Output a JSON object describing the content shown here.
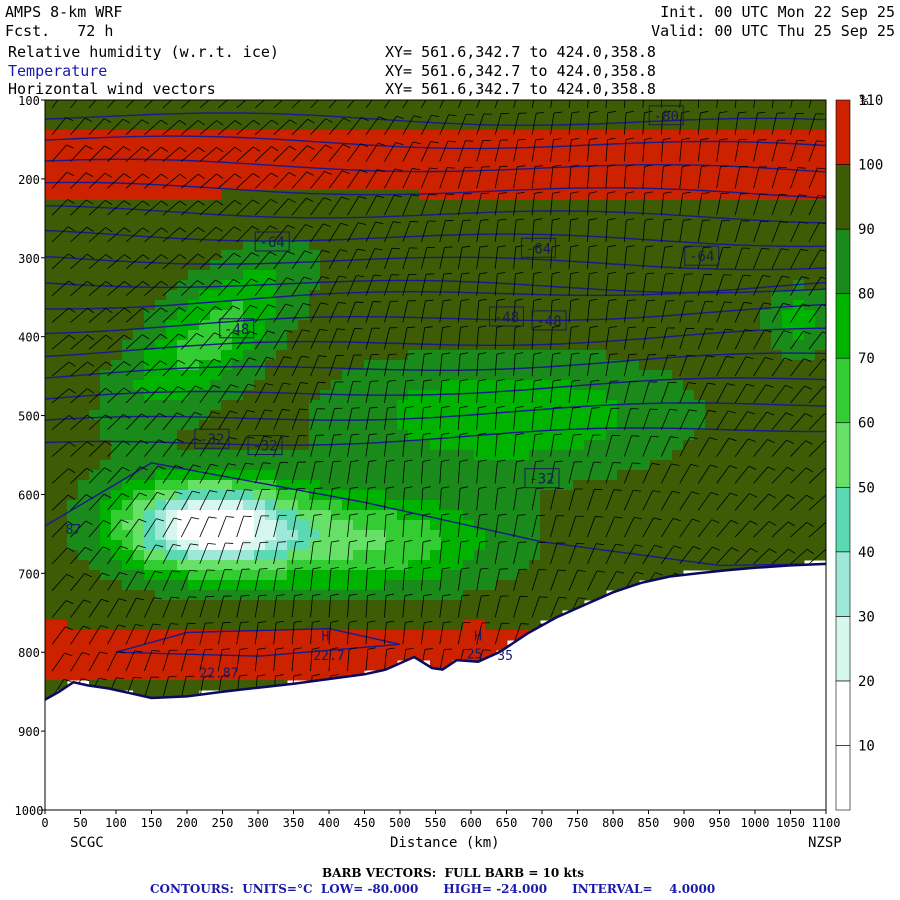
{
  "header": {
    "model": "AMPS 8-km WRF",
    "fcst": "Fcst.   72 h",
    "init": "Init. 00 UTC Mon 22 Sep 25",
    "valid": "Valid: 00 UTC Thu 25 Sep 25",
    "fields": [
      {
        "name": "Relative humidity (w.r.t. ice)",
        "xy": "XY= 561.6,342.7 to 424.0,358.8"
      },
      {
        "name": "Temperature",
        "xy": "XY= 561.6,342.7 to 424.0,358.8"
      },
      {
        "name": "Horizontal wind vectors",
        "xy": "XY= 561.6,342.7 to 424.0,358.8"
      }
    ]
  },
  "chart_data": {
    "type": "heatmap",
    "title": "Relative humidity (w.r.t. ice), Temperature, Horizontal wind vectors",
    "xlabel": "Distance (km)",
    "ylabel": "",
    "x_ticks": [
      0,
      50,
      100,
      150,
      200,
      250,
      300,
      350,
      400,
      450,
      500,
      550,
      600,
      650,
      700,
      750,
      800,
      850,
      900,
      950,
      1000,
      1050,
      1100
    ],
    "xlim": [
      0,
      1100
    ],
    "y_ticks": [
      100,
      200,
      300,
      400,
      500,
      600,
      700,
      800,
      900,
      1000
    ],
    "ylim": [
      1000,
      100
    ],
    "x_endpoints": {
      "left": "SCGC",
      "right": "NZSP"
    },
    "colorbar": {
      "unit": "%",
      "levels": [
        10,
        20,
        30,
        40,
        50,
        60,
        70,
        80,
        90,
        100,
        110
      ],
      "colors": [
        "#ffffff",
        "#ffffff",
        "#d6f7ee",
        "#9de8d8",
        "#5ad9b2",
        "#66e066",
        "#33cc33",
        "#00b300",
        "#1a8a1a",
        "#3d5c05",
        "#cc2200"
      ]
    },
    "temperature_contours": {
      "units": "°C",
      "low": -80,
      "high": -24,
      "interval": 4,
      "labels": [
        {
          "text": "-80",
          "x": 875,
          "p": 120
        },
        {
          "text": "-64",
          "x": 320,
          "p": 280
        },
        {
          "text": "-64",
          "x": 695,
          "p": 288
        },
        {
          "text": "-64",
          "x": 925,
          "p": 298
        },
        {
          "text": "-48",
          "x": 270,
          "p": 390
        },
        {
          "text": "-48",
          "x": 650,
          "p": 375
        },
        {
          "text": "-48",
          "x": 710,
          "p": 380
        },
        {
          "text": "-32",
          "x": 235,
          "p": 530
        },
        {
          "text": "-32",
          "x": 310,
          "p": 538
        },
        {
          "text": "-32",
          "x": 700,
          "p": 580
        }
      ]
    },
    "point_labels": [
      {
        "text": "H",
        "x": 395,
        "p": 785
      },
      {
        "text": "22.7",
        "x": 400,
        "p": 810
      },
      {
        "text": "H",
        "x": 610,
        "p": 785
      },
      {
        "text": "25",
        "x": 605,
        "p": 808
      },
      {
        "text": "35",
        "x": 648,
        "p": 810
      },
      {
        "text": "22.87",
        "x": 245,
        "p": 832
      },
      {
        "text": "87",
        "x": 40,
        "p": 650
      }
    ],
    "footer": {
      "barbs": "BARB VECTORS:  FULL BARB = 10 kts",
      "contours": "CONTOURS:  UNITS=°C  LOW= -80.000      HIGH= -24.000      INTERVAL=    4.0000"
    }
  }
}
